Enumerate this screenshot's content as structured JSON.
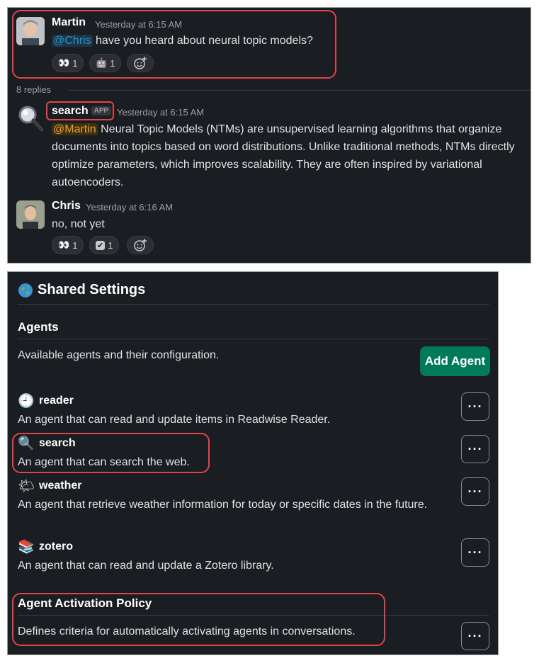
{
  "thread": {
    "root": {
      "author": "Martin",
      "time": "Yesterday at 6:15 AM",
      "mention": "@Chris",
      "text": " have you heard about neural topic models?",
      "reactions": [
        {
          "icon": "eyes-icon",
          "glyph": "👀",
          "count": "1"
        },
        {
          "icon": "robot-icon",
          "glyph": "🤖",
          "count": "1"
        }
      ]
    },
    "replies_label": "8 replies",
    "reply1": {
      "author": "search",
      "badge": "APP",
      "time": "Yesterday at 6:15 AM",
      "mention": "@Martin",
      "text": " Neural Topic Models (NTMs) are unsupervised learning algorithms that organize documents into topics based on word distributions. Unlike traditional methods, NTMs directly optimize parameters, which improves scalability. They are often inspired by variational autoencoders."
    },
    "reply2": {
      "author": "Chris",
      "time": "Yesterday at 6:16 AM",
      "text": "no, not yet",
      "reactions": [
        {
          "icon": "eyes-icon",
          "glyph": "👀",
          "count": "1"
        },
        {
          "icon": "check-icon",
          "glyph": "✔",
          "count": "1"
        }
      ]
    }
  },
  "settings": {
    "title": "Shared Settings",
    "title_icon": "globe-icon",
    "agents_heading": "Agents",
    "agents_desc": "Available agents and their configuration.",
    "add_agent_label": "Add Agent",
    "accent": "#007a5a",
    "more_label": "···",
    "agents": [
      {
        "icon": "clock-icon",
        "glyph": "🕘",
        "name": "reader",
        "desc": "An agent that can read and update items in Readwise Reader."
      },
      {
        "icon": "magnifier-icon",
        "glyph": "🔍",
        "name": "search",
        "desc": "An agent that can search the web."
      },
      {
        "icon": "sun-cloud-icon",
        "glyph": "🌤",
        "name": "weather",
        "desc": "An agent that retrieve weather information for today or specific dates in the future."
      },
      {
        "icon": "books-icon",
        "glyph": "📚",
        "name": "zotero",
        "desc": "An agent that can read and update a Zotero library."
      }
    ],
    "policy_heading": "Agent Activation Policy",
    "policy_desc": "Defines criteria for automatically activating agents in conversations."
  },
  "highlight_color": "#e0454c"
}
